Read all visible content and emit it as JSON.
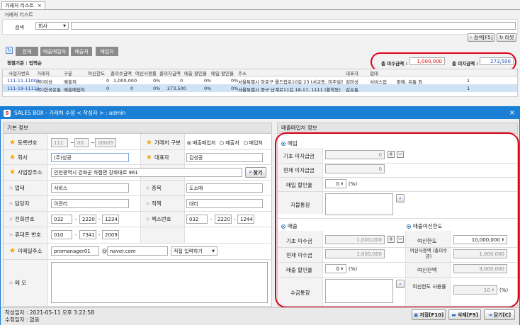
{
  "bg_window": {
    "tab_title": "거래처 리스트",
    "tab_close": "×",
    "panel_title": "거래처 리스트",
    "search": {
      "label": "검색",
      "select_value": "회사",
      "input_value": ""
    },
    "search_button": "검색[F5]",
    "reset_button": "리셋",
    "filters": [
      "전체",
      "매출매입처",
      "매출처",
      "매입처"
    ],
    "sort_text": "정렬기준 : 입력순",
    "total_receivable_label": "총 미수금액 :",
    "total_receivable_value": "1,000,000",
    "total_payable_label": "총 미지급액 :",
    "total_payable_value": "273,500",
    "table": {
      "columns": [
        "사업자번호",
        "거래처",
        "구분",
        "여신한도",
        "총미수금액",
        "여신사용률",
        "총미지급액",
        "매출 할인율",
        "매입 할인율",
        "주소",
        "대표자",
        "업태",
        "종목",
        "담당자",
        "전화",
        "전화번호",
        "팩스번호"
      ],
      "rows": [
        [
          "111-11-11001",
          "(주)미성",
          "매출처",
          "0",
          "1,000,000",
          "0%",
          "0",
          "0%",
          "0%",
          "서울특별시 마포구 월드컵로10길 23 (서교동, 미주빌라)",
          "김미성",
          "서비스업",
          "판매, 유통 외",
          "",
          "",
          "1",
          ""
        ],
        [
          "111-19-11111",
          "(주)한국유통",
          "매출매입처",
          "0",
          "0",
          "0%",
          "273,500",
          "0%",
          "0%",
          "서울특별시 중구 난계로11길 18-17, 1111 (황학동)",
          "김유통",
          "",
          "",
          "",
          "",
          "1",
          ""
        ]
      ]
    }
  },
  "dialog": {
    "title": "SALES BOX - 거래처 수정 < 작성자 > : admin",
    "close": "×",
    "basic_header": "기본 정보",
    "fin_header": "매출매입처 정보",
    "basic": {
      "biz_no_label": "등록번호",
      "biz_no": [
        "111",
        "00",
        "00005"
      ],
      "type_label": "거래처 구분",
      "type_options": [
        "매출매입처",
        "매출처",
        "매입처"
      ],
      "type_selected": "매출매입처",
      "company_label": "회사",
      "company": "(주)성공",
      "ceo_label": "대표자",
      "ceo": "김성공",
      "address_label": "사업장주소",
      "address": "인천광역시 강화군 하점면 강화대로 961",
      "find_button": "찾기",
      "biztype_label": "업태",
      "biztype": "서비스",
      "item_label": "종목",
      "item": "도소매",
      "manager_label": "담당자",
      "manager": "이관리",
      "position_label": "직책",
      "position": "대리",
      "phone_label": "전화번호",
      "phone": [
        "032",
        "2220",
        "1234"
      ],
      "fax_label": "팩스번호",
      "fax": [
        "032",
        "2220",
        "1244"
      ],
      "mobile_label": "휴대폰 번호",
      "mobile": [
        "010",
        "7341",
        "2009"
      ],
      "email_label": "이메일주소",
      "email_id": "promanager01",
      "email_at": "@",
      "email_domain": "naver.com",
      "email_select": "직접 입력하기",
      "memo_label": "메 모",
      "memo": ""
    },
    "fin": {
      "purchase_title": "매입",
      "base_payable_label": "기초 미지급금",
      "base_payable": "0",
      "cur_payable_label": "현재 미지급금",
      "cur_payable": "0",
      "purchase_discount_label": "매입 할인율",
      "purchase_discount": "0",
      "pct": "(%)",
      "pay_account_label": "지불통장",
      "sales_title": "매출",
      "base_receivable_label": "기초 미수금",
      "base_receivable": "1,000,000",
      "cur_receivable_label": "현재 미수금",
      "cur_receivable": "1,000,000",
      "sales_discount_label": "매출 할인율",
      "sales_discount": "0",
      "recv_account_label": "수금통장",
      "credit_title": "매출여신한도",
      "credit_limit_label": "여신한도",
      "credit_limit": "10,000,000",
      "credit_used_label": "여신사용액 (총미수금)",
      "credit_used": "1,000,000",
      "credit_left_label": "여신잔액",
      "credit_left": "9,000,000",
      "credit_rate_label": "여신한도 사용률",
      "credit_rate": "10"
    },
    "footer": {
      "created": "작성일자 : 2021-05-11 오후 3:22:58",
      "modified": "수정일자 : 없음",
      "save": "저장[F10]",
      "delete": "삭제[F9]",
      "close": "닫기[C]"
    }
  },
  "colors": {
    "header_blue": "#1b7fd6",
    "highlight": "#e0001a",
    "row_sel": "#cfe3f7"
  }
}
